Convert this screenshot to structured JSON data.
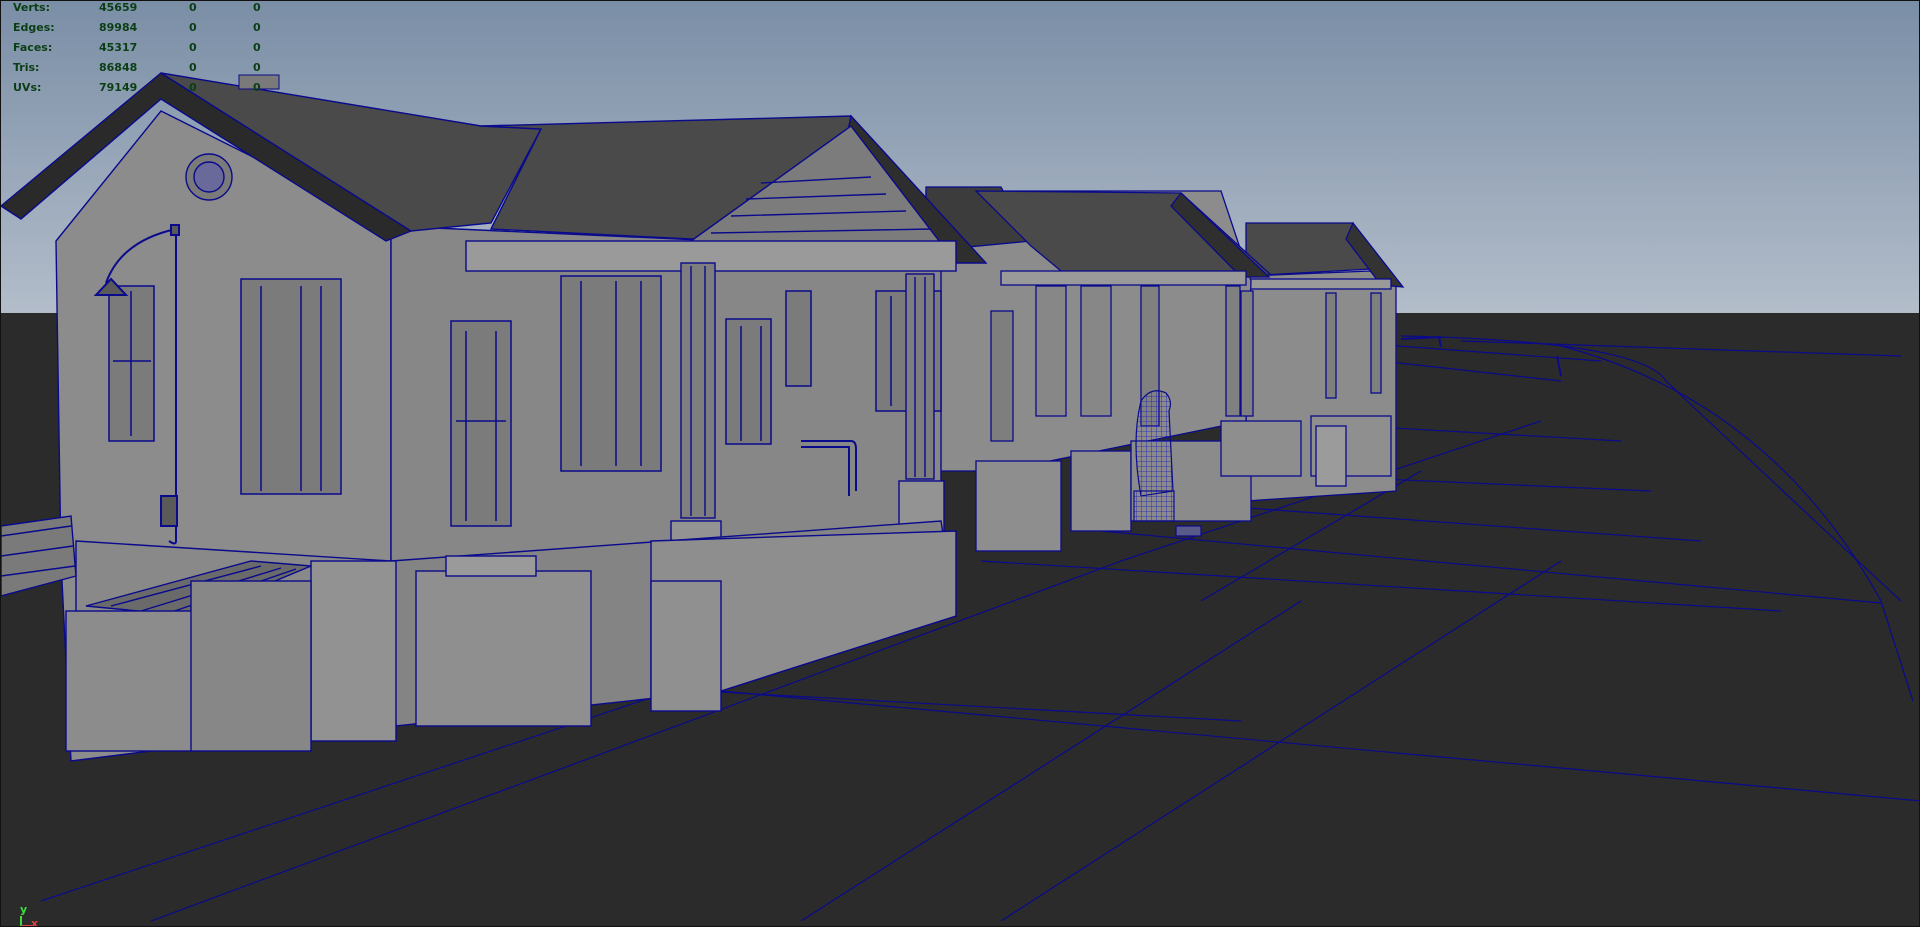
{
  "hud": {
    "rows": [
      {
        "label": "Verts:",
        "total": "45659",
        "selected": "0",
        "component": "0"
      },
      {
        "label": "Edges:",
        "total": "89984",
        "selected": "0",
        "component": "0"
      },
      {
        "label": "Faces:",
        "total": "45317",
        "selected": "0",
        "component": "0"
      },
      {
        "label": "Tris:",
        "total": "86848",
        "selected": "0",
        "component": "0"
      },
      {
        "label": "UVs:",
        "total": "79149",
        "selected": "0",
        "component": "0"
      }
    ]
  },
  "axis": {
    "y_label": "y",
    "x_label": "x"
  },
  "colors": {
    "sky_top": "#7a8ea6",
    "sky_bottom": "#b3bdca",
    "ground": "#2b2b2b",
    "wall": "#8c8c8c",
    "roof": "#4a4a4a",
    "wireframe": "#0a0a8c",
    "hud_text": "#0b3e14"
  }
}
